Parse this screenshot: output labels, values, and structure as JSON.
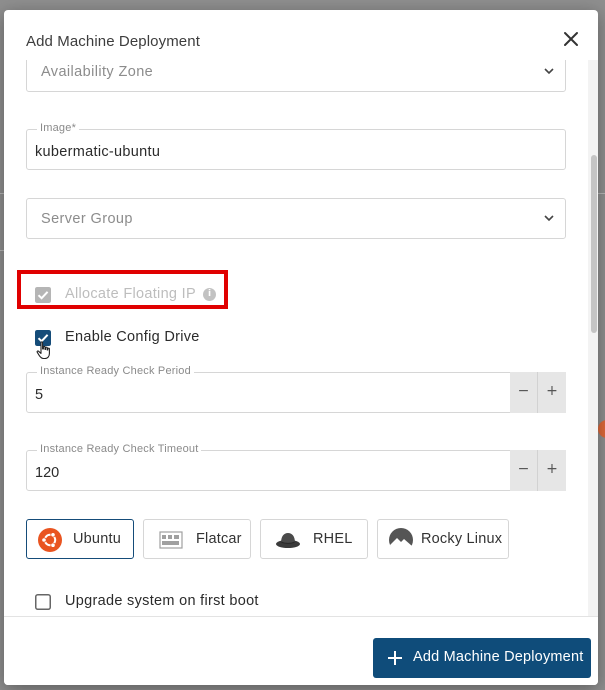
{
  "dialog": {
    "title": "Add Machine Deployment",
    "close_icon": "close-icon"
  },
  "form": {
    "availability_zone": {
      "placeholder": "Availability Zone"
    },
    "image": {
      "label": "Image*",
      "value": "kubermatic-ubuntu"
    },
    "server_group": {
      "placeholder": "Server Group"
    },
    "allocate_floating_ip": {
      "label": "Allocate Floating IP",
      "checked": true,
      "disabled": true,
      "info_icon": "info-icon"
    },
    "enable_config_drive": {
      "label": "Enable Config Drive",
      "checked": true
    },
    "instance_ready_check_period": {
      "label": "Instance Ready Check Period",
      "value": "5"
    },
    "instance_ready_check_timeout": {
      "label": "Instance Ready Check Timeout",
      "value": "120"
    },
    "stepper": {
      "minus": "−",
      "plus": "+"
    },
    "operating_systems": [
      {
        "label": "Ubuntu",
        "icon": "ubuntu-icon",
        "selected": true
      },
      {
        "label": "Flatcar",
        "icon": "flatcar-icon",
        "selected": false
      },
      {
        "label": "RHEL",
        "icon": "rhel-icon",
        "selected": false
      },
      {
        "label": "Rocky Linux",
        "icon": "rocky-linux-icon",
        "selected": false
      }
    ],
    "upgrade_on_boot": {
      "label": "Upgrade system on first boot",
      "checked": false
    }
  },
  "footer": {
    "submit_label": "Add Machine Deployment",
    "submit_icon": "plus-icon"
  },
  "colors": {
    "primary": "#0f4c7a",
    "checkbox_active": "#154c79",
    "checkbox_disabled": "#9e9e9e",
    "highlight": "#e00000",
    "ubuntu_orange": "#e95420"
  }
}
